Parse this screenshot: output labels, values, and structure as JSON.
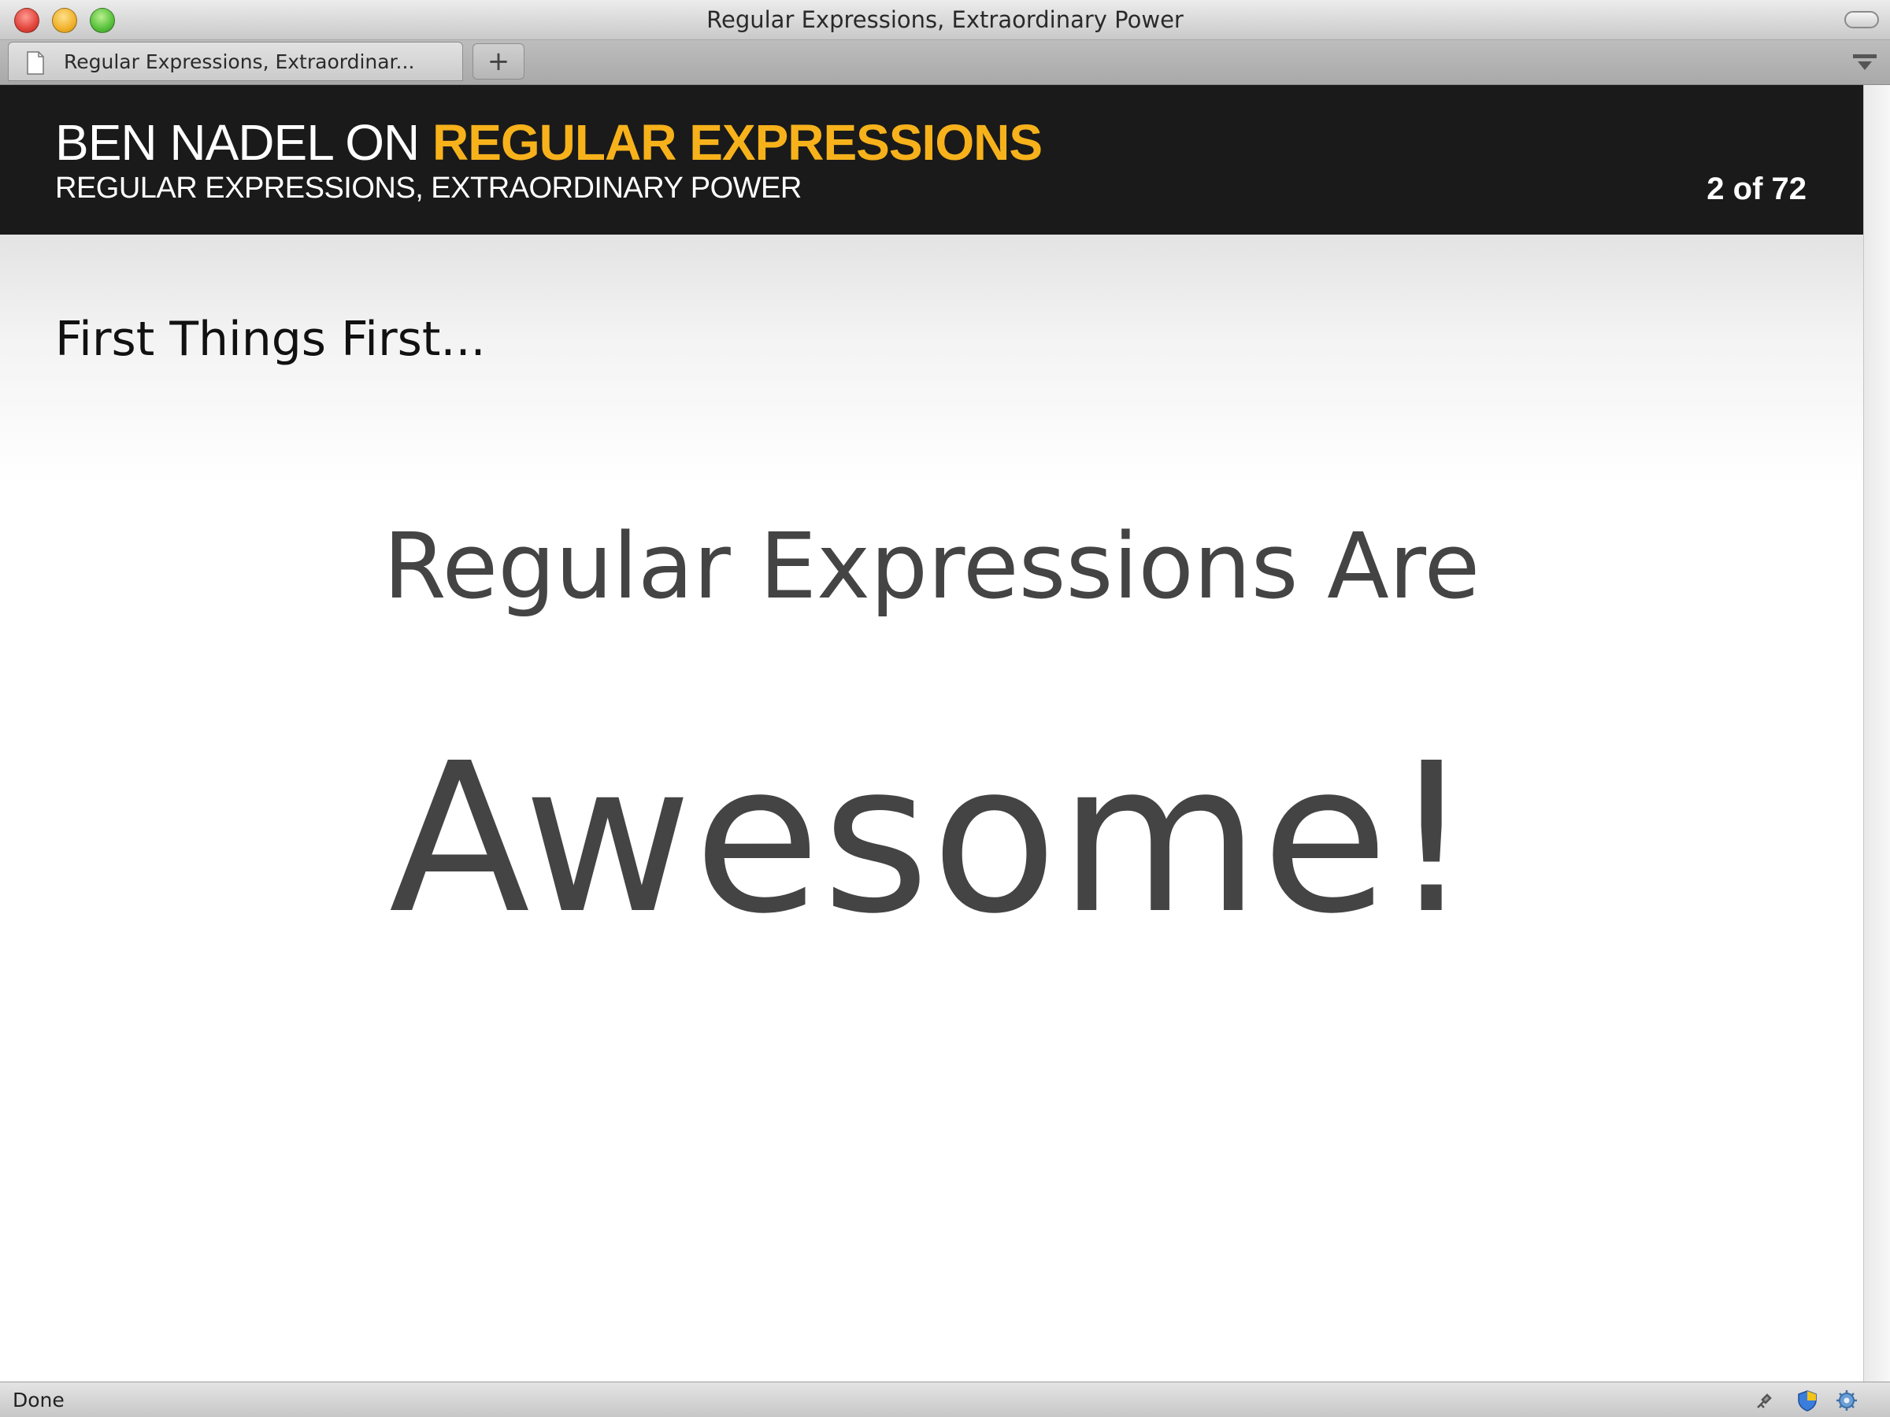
{
  "window": {
    "title": "Regular Expressions, Extraordinary Power"
  },
  "tabs": [
    {
      "label": "Regular Expressions, Extraordinar..."
    }
  ],
  "new_tab_label": "+",
  "slide": {
    "header_prefix": "BEN NADEL ON ",
    "header_highlight": "REGULAR EXPRESSIONS",
    "subtitle": "REGULAR EXPRESSIONS, EXTRAORDINARY POWER",
    "counter": "2 of 72",
    "section_title": "First Things First...",
    "line_one": "Regular Expressions Are",
    "line_two": "Awesome!"
  },
  "status": {
    "text": "Done"
  },
  "colors": {
    "header_background": "#1a1a1a",
    "header_accent": "#f7b21b",
    "body_text": "#444444"
  }
}
